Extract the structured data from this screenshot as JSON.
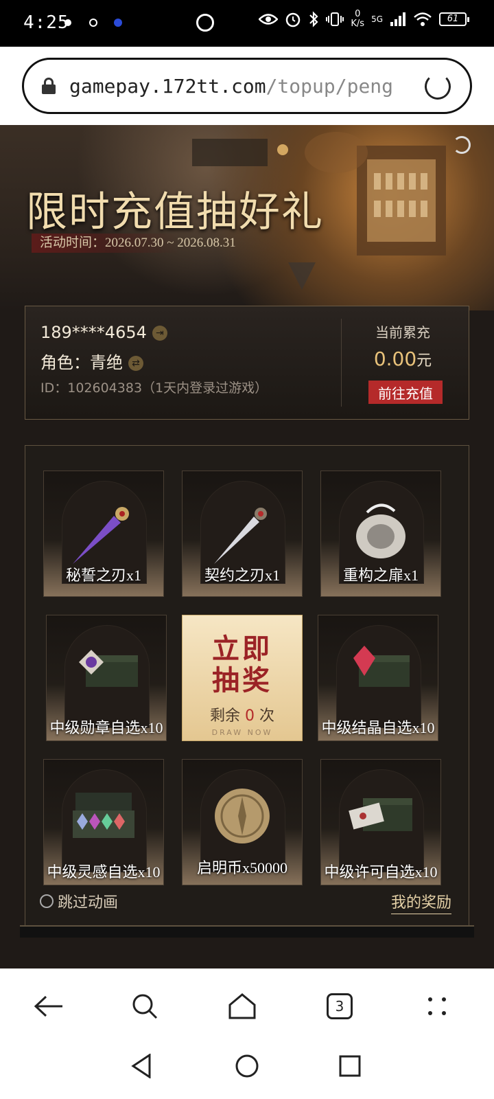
{
  "status_bar": {
    "time": "4:25",
    "net_speed_value": "0",
    "net_speed_unit": "K/s",
    "network": "5G",
    "battery": "61"
  },
  "browser": {
    "url_main": "gamepay.172tt.com",
    "url_path": "/topup/peng/cum"
  },
  "hero": {
    "title": "限时充值抽好礼",
    "date": "活动时间：2026.07.30 ~ 2026.08.31"
  },
  "account": {
    "phone": "189****4654",
    "role": "角色：青绝",
    "id_text": "ID：102604383（1天内登录过游戏）",
    "total_label": "当前累充",
    "total_value": "0.00",
    "total_unit": "元",
    "recharge_button": "前往充值"
  },
  "prizes": [
    {
      "label": "秘誓之刃x1",
      "icon": "purple-dagger-icon"
    },
    {
      "label": "契约之刃x1",
      "icon": "silver-dagger-icon"
    },
    {
      "label": "重构之扉x1",
      "icon": "shell-relic-icon"
    },
    {
      "label": "中级勋章自选x10",
      "icon": "medal-chest-icon"
    },
    {
      "label": "中级结晶自选x10",
      "icon": "crystal-chest-icon"
    },
    {
      "label": "中级灵感自选x10",
      "icon": "gem-case-icon"
    },
    {
      "label": "启明币x50000",
      "icon": "coin-icon"
    },
    {
      "label": "中级许可自选x10",
      "icon": "license-chest-icon"
    }
  ],
  "draw": {
    "title_line1": "立即",
    "title_line2": "抽奖",
    "remain_prefix": "剩余",
    "remain_count": "0",
    "remain_suffix": "次",
    "subtitle": "DRAW NOW"
  },
  "footer_links": {
    "skip_animation": "跳过动画",
    "my_rewards": "我的奖励"
  },
  "browser_toolbar": {
    "tabs_count": "3"
  }
}
